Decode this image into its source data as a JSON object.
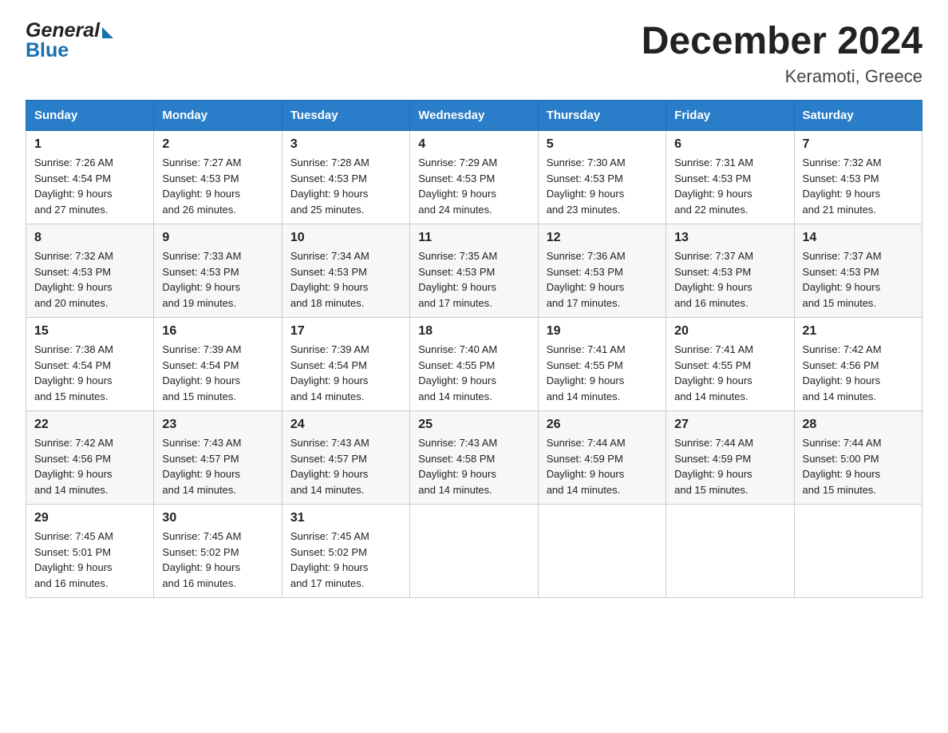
{
  "header": {
    "logo_line1": "General",
    "logo_line2": "Blue",
    "title": "December 2024",
    "subtitle": "Keramoti, Greece"
  },
  "columns": [
    "Sunday",
    "Monday",
    "Tuesday",
    "Wednesday",
    "Thursday",
    "Friday",
    "Saturday"
  ],
  "weeks": [
    [
      {
        "day": "1",
        "sunrise": "7:26 AM",
        "sunset": "4:54 PM",
        "daylight": "9 hours and 27 minutes."
      },
      {
        "day": "2",
        "sunrise": "7:27 AM",
        "sunset": "4:53 PM",
        "daylight": "9 hours and 26 minutes."
      },
      {
        "day": "3",
        "sunrise": "7:28 AM",
        "sunset": "4:53 PM",
        "daylight": "9 hours and 25 minutes."
      },
      {
        "day": "4",
        "sunrise": "7:29 AM",
        "sunset": "4:53 PM",
        "daylight": "9 hours and 24 minutes."
      },
      {
        "day": "5",
        "sunrise": "7:30 AM",
        "sunset": "4:53 PM",
        "daylight": "9 hours and 23 minutes."
      },
      {
        "day": "6",
        "sunrise": "7:31 AM",
        "sunset": "4:53 PM",
        "daylight": "9 hours and 22 minutes."
      },
      {
        "day": "7",
        "sunrise": "7:32 AM",
        "sunset": "4:53 PM",
        "daylight": "9 hours and 21 minutes."
      }
    ],
    [
      {
        "day": "8",
        "sunrise": "7:32 AM",
        "sunset": "4:53 PM",
        "daylight": "9 hours and 20 minutes."
      },
      {
        "day": "9",
        "sunrise": "7:33 AM",
        "sunset": "4:53 PM",
        "daylight": "9 hours and 19 minutes."
      },
      {
        "day": "10",
        "sunrise": "7:34 AM",
        "sunset": "4:53 PM",
        "daylight": "9 hours and 18 minutes."
      },
      {
        "day": "11",
        "sunrise": "7:35 AM",
        "sunset": "4:53 PM",
        "daylight": "9 hours and 17 minutes."
      },
      {
        "day": "12",
        "sunrise": "7:36 AM",
        "sunset": "4:53 PM",
        "daylight": "9 hours and 17 minutes."
      },
      {
        "day": "13",
        "sunrise": "7:37 AM",
        "sunset": "4:53 PM",
        "daylight": "9 hours and 16 minutes."
      },
      {
        "day": "14",
        "sunrise": "7:37 AM",
        "sunset": "4:53 PM",
        "daylight": "9 hours and 15 minutes."
      }
    ],
    [
      {
        "day": "15",
        "sunrise": "7:38 AM",
        "sunset": "4:54 PM",
        "daylight": "9 hours and 15 minutes."
      },
      {
        "day": "16",
        "sunrise": "7:39 AM",
        "sunset": "4:54 PM",
        "daylight": "9 hours and 15 minutes."
      },
      {
        "day": "17",
        "sunrise": "7:39 AM",
        "sunset": "4:54 PM",
        "daylight": "9 hours and 14 minutes."
      },
      {
        "day": "18",
        "sunrise": "7:40 AM",
        "sunset": "4:55 PM",
        "daylight": "9 hours and 14 minutes."
      },
      {
        "day": "19",
        "sunrise": "7:41 AM",
        "sunset": "4:55 PM",
        "daylight": "9 hours and 14 minutes."
      },
      {
        "day": "20",
        "sunrise": "7:41 AM",
        "sunset": "4:55 PM",
        "daylight": "9 hours and 14 minutes."
      },
      {
        "day": "21",
        "sunrise": "7:42 AM",
        "sunset": "4:56 PM",
        "daylight": "9 hours and 14 minutes."
      }
    ],
    [
      {
        "day": "22",
        "sunrise": "7:42 AM",
        "sunset": "4:56 PM",
        "daylight": "9 hours and 14 minutes."
      },
      {
        "day": "23",
        "sunrise": "7:43 AM",
        "sunset": "4:57 PM",
        "daylight": "9 hours and 14 minutes."
      },
      {
        "day": "24",
        "sunrise": "7:43 AM",
        "sunset": "4:57 PM",
        "daylight": "9 hours and 14 minutes."
      },
      {
        "day": "25",
        "sunrise": "7:43 AM",
        "sunset": "4:58 PM",
        "daylight": "9 hours and 14 minutes."
      },
      {
        "day": "26",
        "sunrise": "7:44 AM",
        "sunset": "4:59 PM",
        "daylight": "9 hours and 14 minutes."
      },
      {
        "day": "27",
        "sunrise": "7:44 AM",
        "sunset": "4:59 PM",
        "daylight": "9 hours and 15 minutes."
      },
      {
        "day": "28",
        "sunrise": "7:44 AM",
        "sunset": "5:00 PM",
        "daylight": "9 hours and 15 minutes."
      }
    ],
    [
      {
        "day": "29",
        "sunrise": "7:45 AM",
        "sunset": "5:01 PM",
        "daylight": "9 hours and 16 minutes."
      },
      {
        "day": "30",
        "sunrise": "7:45 AM",
        "sunset": "5:02 PM",
        "daylight": "9 hours and 16 minutes."
      },
      {
        "day": "31",
        "sunrise": "7:45 AM",
        "sunset": "5:02 PM",
        "daylight": "9 hours and 17 minutes."
      },
      null,
      null,
      null,
      null
    ]
  ],
  "labels": {
    "sunrise": "Sunrise:",
    "sunset": "Sunset:",
    "daylight": "Daylight:"
  }
}
